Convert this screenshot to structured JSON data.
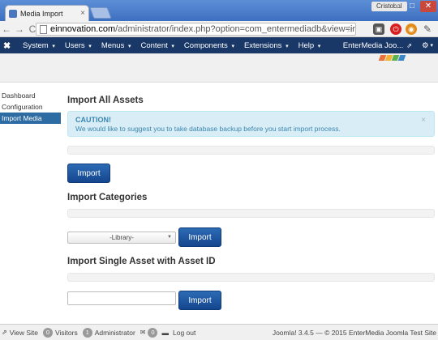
{
  "browser": {
    "tab_title": "Media Import",
    "tab_close": "×",
    "user": "Cristobal",
    "win_min": "–",
    "win_max": "□",
    "win_close": "✕",
    "back": "←",
    "forward": "→",
    "reload": "C",
    "url_host": "einnovation.com",
    "url_rest": "/administrator/index.php?option=com_entermediadb&view=importmedia",
    "star": "☆"
  },
  "joomla_nav": {
    "logo": "✖",
    "menu": [
      {
        "label": "System"
      },
      {
        "label": "Users"
      },
      {
        "label": "Menus"
      },
      {
        "label": "Content"
      },
      {
        "label": "Components"
      },
      {
        "label": "Extensions"
      },
      {
        "label": "Help"
      }
    ],
    "caret": "▾",
    "site_name": "EnterMedia Joo...",
    "external_icon": "⇗",
    "gear": "⚙"
  },
  "sidebar": {
    "items": [
      {
        "label": "Dashboard",
        "active": false
      },
      {
        "label": "Configuration",
        "active": false
      },
      {
        "label": "Import Media",
        "active": true
      }
    ]
  },
  "main": {
    "import_all": {
      "heading": "Import All Assets",
      "alert_title": "CAUTION!",
      "alert_text": "We would like to suggest you to take database backup before you start import process.",
      "alert_close": "×",
      "button": "Import"
    },
    "import_categories": {
      "heading": "Import Categories",
      "select_value": "-Library-",
      "button": "Import"
    },
    "import_single": {
      "heading": "Import Single Asset with Asset ID",
      "input_value": "",
      "input_placeholder": "",
      "button": "Import"
    }
  },
  "statusbar": {
    "view_site": "View Site",
    "visitors_count": "0",
    "visitors_label": "Visitors",
    "admin_count": "1",
    "admin_label": "Administrator",
    "messages_count": "0",
    "logout": "Log out",
    "footer": "Joomla! 3.4.5 — © 2015 EnterMedia Joomla Test Site"
  },
  "colors": {
    "joomla_nav_bg": "#1a3867",
    "button_blue": "#14468e",
    "alert_bg": "#d9edf7",
    "alert_text": "#3a87ad",
    "sidebar_active": "#2d6ca2"
  }
}
